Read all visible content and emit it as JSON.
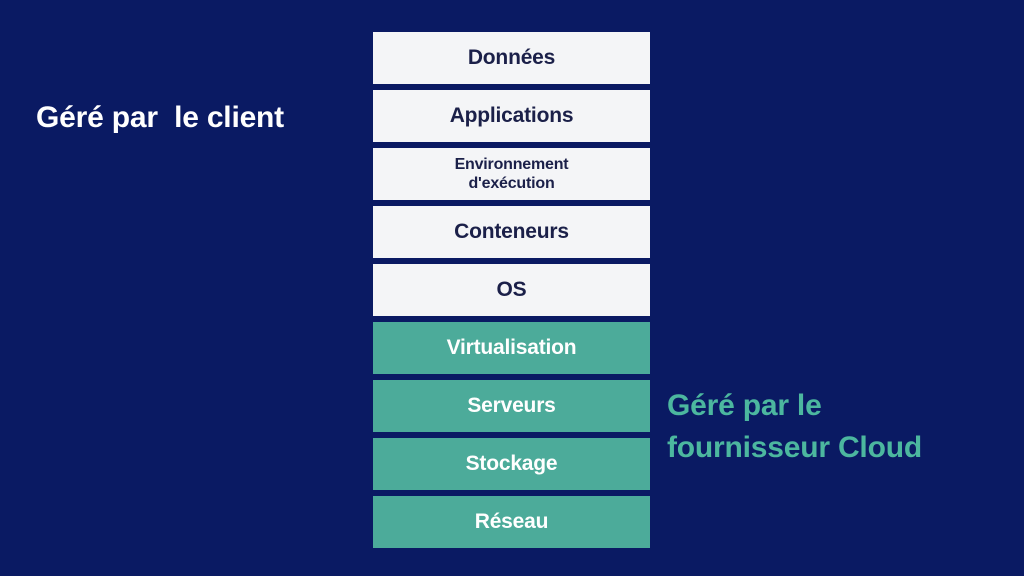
{
  "background_color": "#0a1a63",
  "captions": {
    "left": {
      "text": "Géré par  le client",
      "color": "#ffffff"
    },
    "right": {
      "line1": "Géré par le",
      "line2": "fournisseur Cloud",
      "color": "#4cb79f"
    }
  },
  "stack": {
    "layers": [
      {
        "label": "Données",
        "group": "customer",
        "fill": "#f4f5f7",
        "text_color": "#1b2049",
        "size": "normal"
      },
      {
        "label": "Applications",
        "group": "customer",
        "fill": "#f4f5f7",
        "text_color": "#1b2049",
        "size": "normal"
      },
      {
        "label": "Environnement\nd'exécution",
        "group": "customer",
        "fill": "#f4f5f7",
        "text_color": "#1b2049",
        "size": "small"
      },
      {
        "label": "Conteneurs",
        "group": "customer",
        "fill": "#f4f5f7",
        "text_color": "#1b2049",
        "size": "normal"
      },
      {
        "label": "OS",
        "group": "customer",
        "fill": "#f4f5f7",
        "text_color": "#1b2049",
        "size": "normal"
      },
      {
        "label": "Virtualisation",
        "group": "provider",
        "fill": "#4cab9a",
        "text_color": "#ffffff",
        "size": "normal"
      },
      {
        "label": "Serveurs",
        "group": "provider",
        "fill": "#4cab9a",
        "text_color": "#ffffff",
        "size": "normal"
      },
      {
        "label": "Stockage",
        "group": "provider",
        "fill": "#4cab9a",
        "text_color": "#ffffff",
        "size": "normal"
      },
      {
        "label": "Réseau",
        "group": "provider",
        "fill": "#4cab9a",
        "text_color": "#ffffff",
        "size": "normal"
      }
    ]
  }
}
